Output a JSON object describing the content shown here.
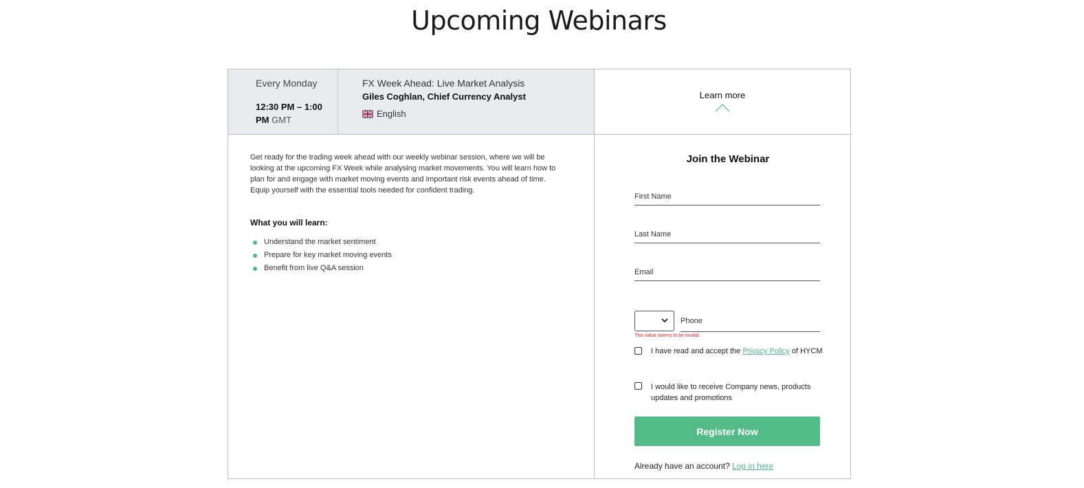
{
  "page": {
    "title": "Upcoming Webinars"
  },
  "webinar": {
    "schedule": {
      "day": "Every Monday",
      "time": "12:30 PM – 1:00 PM",
      "timezone": "GMT"
    },
    "title": "FX Week Ahead: Live Market Analysis",
    "speaker": "Giles Coghlan, Chief Currency Analyst",
    "language": "English",
    "learn_more": "Learn more",
    "description": "Get ready for the trading week ahead with our weekly webinar session, where we will be looking at the upcoming FX Week while analysing market movements. You will learn how to plan for and engage with market moving events and important risk events ahead of time. Equip yourself with the essential tools needed for confident trading.",
    "learn_heading": "What you will learn:",
    "learn_items": [
      "Understand the market sentiment",
      "Prepare for key market moving events",
      "Benefit from live Q&A session"
    ]
  },
  "form": {
    "title": "Join the Webinar",
    "first_name_placeholder": "First Name",
    "last_name_placeholder": "Last Name",
    "email_placeholder": "Email",
    "phone_placeholder": "Phone",
    "phone_error": "This value seems to be invalid.",
    "privacy_prefix": "I have read and accept the",
    "privacy_link": "Privacy Policy",
    "privacy_suffix": "of HYCM",
    "news_opt_in": "I would like to receive Company news, products updates and promotions",
    "register_label": "Register Now",
    "account_prefix": "Already have an account?",
    "login_link": "Log in here"
  },
  "colors": {
    "accent": "#52bb87",
    "header_bg": "#e9ebee",
    "error": "#dd2222"
  }
}
